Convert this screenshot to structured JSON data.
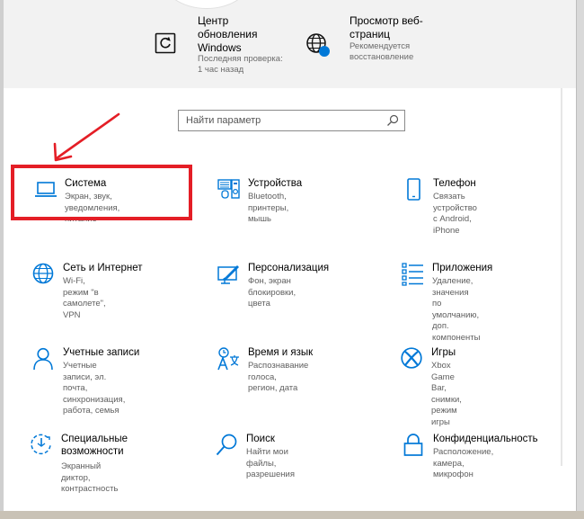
{
  "header": {
    "update": {
      "title": "Центр\nобновления\nWindows",
      "sub": "Последняя проверка:\n1 час назад"
    },
    "browse": {
      "title": "Просмотр веб-\nстраниц",
      "sub": "Рекомендуется\nвосстановление"
    }
  },
  "search": {
    "placeholder": "Найти параметр"
  },
  "tiles": [
    {
      "title": "Система",
      "desc": "Экран, звук, уведомления,\nпитание",
      "icon": "laptop-icon"
    },
    {
      "title": "Устройства",
      "desc": "Bluetooth, принтеры, мышь",
      "icon": "devices-icon"
    },
    {
      "title": "Телефон",
      "desc": "Связать устройство с Android,\niPhone",
      "icon": "phone-icon"
    },
    {
      "title": "Сеть и Интернет",
      "desc": "Wi-Fi, режим \"в самолете\",\nVPN",
      "icon": "globe-icon"
    },
    {
      "title": "Персонализация",
      "desc": "Фон, экран блокировки, цвета",
      "icon": "personalization-icon"
    },
    {
      "title": "Приложения",
      "desc": "Удаление, значения по\nумолчанию, доп. компоненты",
      "icon": "apps-icon"
    },
    {
      "title": "Учетные записи",
      "desc": "Учетные записи, эл. почта,\nсинхронизация, работа, семья",
      "icon": "person-icon"
    },
    {
      "title": "Время и язык",
      "desc": "Распознавание голоса,\nрегион, дата",
      "icon": "time-language-icon"
    },
    {
      "title": "Игры",
      "desc": "Xbox Game Bar, снимки,\nрежим игры",
      "icon": "xbox-icon"
    },
    {
      "title": "Специальные\nвозможности",
      "desc": "Экранный диктор,\nконтрастность",
      "icon": "accessibility-icon"
    },
    {
      "title": "Поиск",
      "desc": "Найти мои файлы,\nразрешения",
      "icon": "search-icon"
    },
    {
      "title": "Конфиденциальность",
      "desc": "Расположение, камера,\nмикрофон",
      "icon": "lock-icon"
    }
  ],
  "colors": {
    "accent": "#0078d7",
    "highlight": "#e41e26",
    "header_bg": "#f2f2f2"
  }
}
